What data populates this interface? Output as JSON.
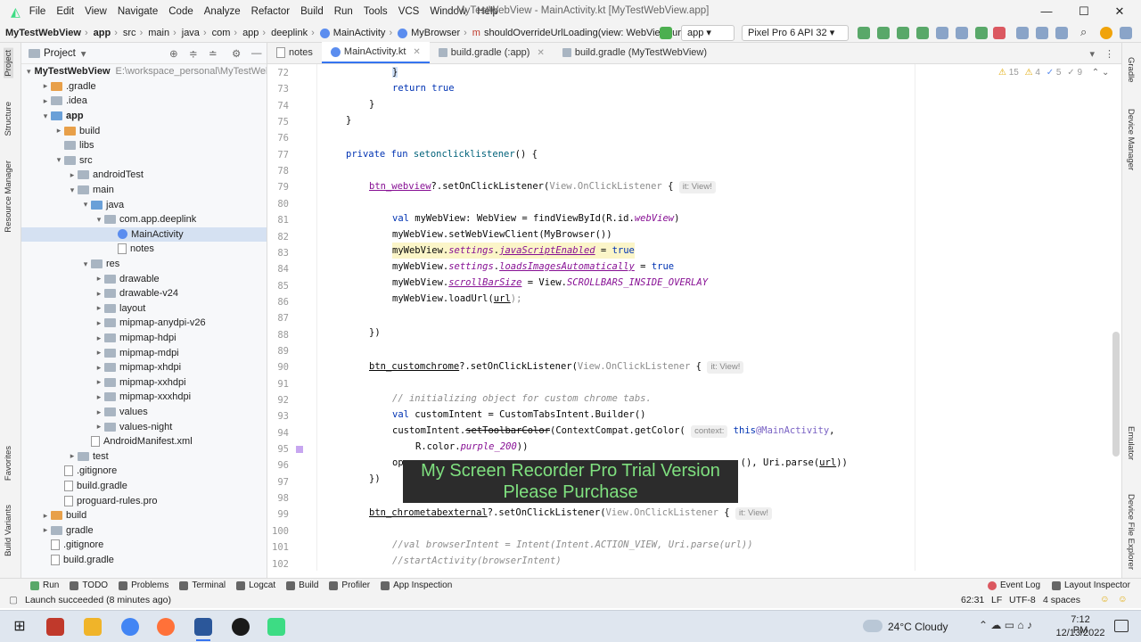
{
  "window": {
    "title": "MyTestWebView - MainActivity.kt [MyTestWebView.app]",
    "menu": [
      "File",
      "Edit",
      "View",
      "Navigate",
      "Code",
      "Analyze",
      "Refactor",
      "Build",
      "Run",
      "Tools",
      "VCS",
      "Window",
      "Help"
    ]
  },
  "breadcrumb": [
    "MyTestWebView",
    "app",
    "src",
    "main",
    "java",
    "com",
    "app",
    "deeplink",
    "MainActivity",
    "MyBrowser",
    "shouldOverrideUrlLoading(view: WebView, url: St..."
  ],
  "toolbar": {
    "run_config": "app",
    "device": "Pixel Pro 6 API 32"
  },
  "left_strip": [
    "Project",
    "Structure",
    "Resource Manager",
    "Favorites",
    "Build Variants"
  ],
  "right_strip": [
    "Gradle",
    "Device Manager",
    "Emulator",
    "Device File Explorer"
  ],
  "project": {
    "header": "Project",
    "root_label": "MyTestWebView",
    "root_path": "E:\\workspace_personal\\MyTestWeb",
    "items": [
      {
        "label": ".gradle",
        "type": "folder-orange",
        "indent": 1,
        "arrow": "▸"
      },
      {
        "label": ".idea",
        "type": "folder",
        "indent": 1,
        "arrow": "▸"
      },
      {
        "label": "app",
        "type": "folder-blue",
        "indent": 1,
        "arrow": "▾",
        "bold": true
      },
      {
        "label": "build",
        "type": "folder-orange",
        "indent": 2,
        "arrow": "▸"
      },
      {
        "label": "libs",
        "type": "folder",
        "indent": 2,
        "arrow": ""
      },
      {
        "label": "src",
        "type": "folder",
        "indent": 2,
        "arrow": "▾"
      },
      {
        "label": "androidTest",
        "type": "folder",
        "indent": 3,
        "arrow": "▸"
      },
      {
        "label": "main",
        "type": "folder",
        "indent": 3,
        "arrow": "▾"
      },
      {
        "label": "java",
        "type": "folder-blue",
        "indent": 4,
        "arrow": "▾"
      },
      {
        "label": "com.app.deeplink",
        "type": "folder",
        "indent": 5,
        "arrow": "▾"
      },
      {
        "label": "MainActivity",
        "type": "kt",
        "indent": 6,
        "arrow": "",
        "selected": true
      },
      {
        "label": "notes",
        "type": "file",
        "indent": 6,
        "arrow": ""
      },
      {
        "label": "res",
        "type": "folder",
        "indent": 4,
        "arrow": "▾"
      },
      {
        "label": "drawable",
        "type": "folder",
        "indent": 5,
        "arrow": "▸"
      },
      {
        "label": "drawable-v24",
        "type": "folder",
        "indent": 5,
        "arrow": "▸"
      },
      {
        "label": "layout",
        "type": "folder",
        "indent": 5,
        "arrow": "▸"
      },
      {
        "label": "mipmap-anydpi-v26",
        "type": "folder",
        "indent": 5,
        "arrow": "▸"
      },
      {
        "label": "mipmap-hdpi",
        "type": "folder",
        "indent": 5,
        "arrow": "▸"
      },
      {
        "label": "mipmap-mdpi",
        "type": "folder",
        "indent": 5,
        "arrow": "▸"
      },
      {
        "label": "mipmap-xhdpi",
        "type": "folder",
        "indent": 5,
        "arrow": "▸"
      },
      {
        "label": "mipmap-xxhdpi",
        "type": "folder",
        "indent": 5,
        "arrow": "▸"
      },
      {
        "label": "mipmap-xxxhdpi",
        "type": "folder",
        "indent": 5,
        "arrow": "▸"
      },
      {
        "label": "values",
        "type": "folder",
        "indent": 5,
        "arrow": "▸"
      },
      {
        "label": "values-night",
        "type": "folder",
        "indent": 5,
        "arrow": "▸"
      },
      {
        "label": "AndroidManifest.xml",
        "type": "file",
        "indent": 4,
        "arrow": ""
      },
      {
        "label": "test",
        "type": "folder",
        "indent": 3,
        "arrow": "▸"
      },
      {
        "label": ".gitignore",
        "type": "file",
        "indent": 2,
        "arrow": ""
      },
      {
        "label": "build.gradle",
        "type": "file",
        "indent": 2,
        "arrow": ""
      },
      {
        "label": "proguard-rules.pro",
        "type": "file",
        "indent": 2,
        "arrow": ""
      },
      {
        "label": "build",
        "type": "folder-orange",
        "indent": 1,
        "arrow": "▸"
      },
      {
        "label": "gradle",
        "type": "folder",
        "indent": 1,
        "arrow": "▸"
      },
      {
        "label": ".gitignore",
        "type": "file",
        "indent": 1,
        "arrow": ""
      },
      {
        "label": "build.gradle",
        "type": "file",
        "indent": 1,
        "arrow": ""
      }
    ]
  },
  "tabs": [
    {
      "label": "notes",
      "active": false
    },
    {
      "label": "MainActivity.kt",
      "active": true
    },
    {
      "label": "build.gradle (:app)",
      "active": false
    },
    {
      "label": "build.gradle (MyTestWebView)",
      "active": false
    }
  ],
  "inspections": {
    "warnings": "15",
    "weak": "4",
    "typos": "5",
    "other": "9"
  },
  "code": {
    "line_numbers": [
      "72",
      "73",
      "74",
      "75",
      "76",
      "77",
      "78",
      "79",
      "80",
      "81",
      "82",
      "83",
      "84",
      "85",
      "86",
      "87",
      "88",
      "89",
      "90",
      "91",
      "92",
      "93",
      "94",
      "95",
      "96",
      "97",
      "98",
      "99",
      "100",
      "101",
      "102"
    ],
    "l72": "}",
    "l73_kw": "return",
    "l73_val": "true",
    "l74": "}",
    "l75": "}",
    "l77_a": "private fun",
    "l77_b": "setonclicklistener",
    "l77_c": "() {",
    "l79_a": "btn_webview",
    "l79_b": "?.setOnClickListener(",
    "l79_c": "View.OnClickListener",
    "l79_d": " {",
    "l79_hint": "it: View!",
    "l81_a": "val",
    "l81_b": " myWebView: WebView = findViewById(R.id.",
    "l81_c": "webView",
    "l81_d": ")",
    "l82": "myWebView.setWebViewClient(MyBrowser())",
    "l83_a": "myWebView.",
    "l83_b": "settings",
    "l83_c": ".",
    "l83_d": "javaScriptEnabled",
    "l83_e": " = ",
    "l83_f": "true",
    "l84_a": "myWebView.",
    "l84_b": "settings",
    "l84_c": ".",
    "l84_d": "loadsImagesAutomatically",
    "l84_e": " = ",
    "l84_f": "true",
    "l85_a": "myWebView.",
    "l85_b": "scrollBarSize",
    "l85_c": " = View.",
    "l85_d": "SCROLLBARS_INSIDE_OVERLAY",
    "l86_a": "myWebView.loadUrl(",
    "l86_b": "url",
    "l86_c": ");",
    "l88": "})",
    "l90_a": "btn_customchrome",
    "l90_b": "?.setOnClickListener(",
    "l90_c": "View.OnClickListener",
    "l90_d": " {",
    "l90_hint": "it: View!",
    "l92": "// initializing object for custom chrome tabs.",
    "l93_a": "val",
    "l93_b": " customIntent = CustomTabsIntent.Builder()",
    "l94_a": "customIntent.",
    "l94_b": "setToolbarColor",
    "l94_c": "(ContextCompat.getColor(",
    "l94_hint": "context:",
    "l94_d": "this",
    "l94_e": "@MainActivity",
    "l94_f": ",",
    "l95_a": "R.color.",
    "l95_b": "purple_200",
    "l95_c": "))",
    "l96_a": "op",
    "l96_b": "(), Uri.parse(",
    "l96_c": "url",
    "l96_d": "))",
    "l97": "})",
    "l99_a": "btn_chrometabexternal",
    "l99_b": "?.setOnClickListener(",
    "l99_c": "View.OnClickListener",
    "l99_d": " {",
    "l99_hint": "it: View!",
    "l101": "//val browserIntent = Intent(Intent.ACTION_VIEW, Uri.parse(url))",
    "l102": "//startActivity(browserIntent)"
  },
  "watermark": {
    "line1": "My Screen Recorder Pro Trial Version",
    "line2": "Please Purchase"
  },
  "bottom_tools": [
    "Run",
    "TODO",
    "Problems",
    "Terminal",
    "Logcat",
    "Build",
    "Profiler",
    "App Inspection"
  ],
  "bottom_right_tools": [
    "Event Log",
    "Layout Inspector"
  ],
  "status": {
    "message": "Launch succeeded (8 minutes ago)",
    "position": "62:31",
    "line_sep": "LF",
    "encoding": "UTF-8",
    "indent": "4 spaces"
  },
  "taskbar": {
    "weather": "24°C  Cloudy",
    "time": "7:12 PM",
    "date": "12/13/2022"
  },
  "colors": {
    "accent": "#3574f0",
    "keyword": "#0033b3",
    "property": "#871094",
    "comment": "#8c8c8c"
  }
}
